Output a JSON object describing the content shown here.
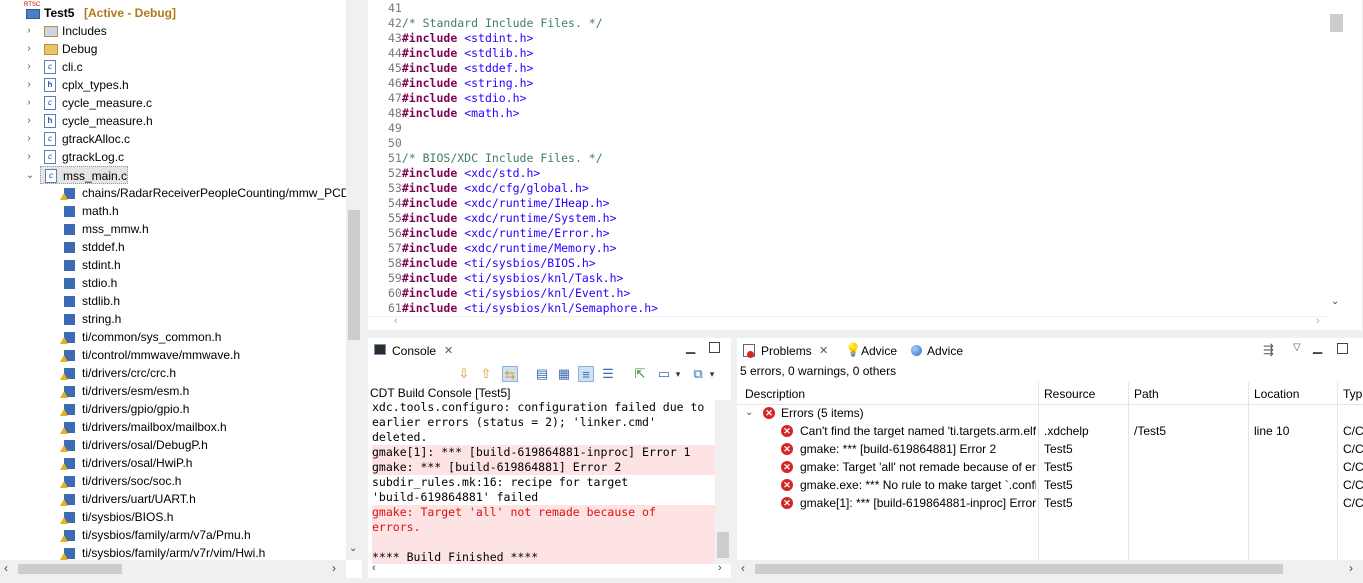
{
  "explorer": {
    "project": {
      "name": "Test5",
      "status": "[Active - Debug]",
      "badge": "RTSC"
    },
    "items": [
      {
        "label": "Includes",
        "icon": "includes-icon",
        "arrow": "›"
      },
      {
        "label": "Debug",
        "icon": "folder-icon",
        "arrow": "›"
      },
      {
        "label": "cli.c",
        "icon": "c-file-icon",
        "arrow": "›"
      },
      {
        "label": "cplx_types.h",
        "icon": "h-file-icon",
        "arrow": "›"
      },
      {
        "label": "cycle_measure.c",
        "icon": "c-file-icon",
        "arrow": "›"
      },
      {
        "label": "cycle_measure.h",
        "icon": "h-file-icon",
        "arrow": "›"
      },
      {
        "label": "gtrackAlloc.c",
        "icon": "c-file-icon",
        "arrow": "›"
      },
      {
        "label": "gtrackLog.c",
        "icon": "c-file-icon",
        "arrow": "›"
      },
      {
        "label": "mss_main.c",
        "icon": "c-file-icon",
        "arrow": "⌄"
      }
    ],
    "includes": [
      {
        "label": "chains/RadarReceiverPeopleCounting/mmw_PCD",
        "warn": true
      },
      {
        "label": "math.h",
        "warn": false
      },
      {
        "label": "mss_mmw.h",
        "warn": false
      },
      {
        "label": "stddef.h",
        "warn": false
      },
      {
        "label": "stdint.h",
        "warn": false
      },
      {
        "label": "stdio.h",
        "warn": false
      },
      {
        "label": "stdlib.h",
        "warn": false
      },
      {
        "label": "string.h",
        "warn": false
      },
      {
        "label": "ti/common/sys_common.h",
        "warn": true
      },
      {
        "label": "ti/control/mmwave/mmwave.h",
        "warn": true
      },
      {
        "label": "ti/drivers/crc/crc.h",
        "warn": true
      },
      {
        "label": "ti/drivers/esm/esm.h",
        "warn": true
      },
      {
        "label": "ti/drivers/gpio/gpio.h",
        "warn": true
      },
      {
        "label": "ti/drivers/mailbox/mailbox.h",
        "warn": true
      },
      {
        "label": "ti/drivers/osal/DebugP.h",
        "warn": true
      },
      {
        "label": "ti/drivers/osal/HwiP.h",
        "warn": true
      },
      {
        "label": "ti/drivers/soc/soc.h",
        "warn": true
      },
      {
        "label": "ti/drivers/uart/UART.h",
        "warn": true
      },
      {
        "label": "ti/sysbios/BIOS.h",
        "warn": true
      },
      {
        "label": "ti/sysbios/family/arm/v7a/Pmu.h",
        "warn": true
      },
      {
        "label": "ti/sysbios/family/arm/v7r/vim/Hwi.h",
        "warn": true
      }
    ]
  },
  "editor": {
    "lines": [
      {
        "n": "41",
        "kind": "blank",
        "text": ""
      },
      {
        "n": "42",
        "kind": "comment",
        "text": "/* Standard Include Files. */"
      },
      {
        "n": "43",
        "kind": "include",
        "text": "<stdint.h>"
      },
      {
        "n": "44",
        "kind": "include",
        "text": "<stdlib.h>"
      },
      {
        "n": "45",
        "kind": "include",
        "text": "<stddef.h>"
      },
      {
        "n": "46",
        "kind": "include",
        "text": "<string.h>"
      },
      {
        "n": "47",
        "kind": "include",
        "text": "<stdio.h>"
      },
      {
        "n": "48",
        "kind": "include",
        "text": "<math.h>"
      },
      {
        "n": "49",
        "kind": "blank",
        "text": ""
      },
      {
        "n": "50",
        "kind": "blank",
        "text": ""
      },
      {
        "n": "51",
        "kind": "comment",
        "text": "/* BIOS/XDC Include Files. */"
      },
      {
        "n": "52",
        "kind": "include",
        "text": "<xdc/std.h>"
      },
      {
        "n": "53",
        "kind": "include",
        "text": "<xdc/cfg/global.h>"
      },
      {
        "n": "54",
        "kind": "include",
        "text": "<xdc/runtime/IHeap.h>"
      },
      {
        "n": "55",
        "kind": "include",
        "text": "<xdc/runtime/System.h>"
      },
      {
        "n": "56",
        "kind": "include",
        "text": "<xdc/runtime/Error.h>"
      },
      {
        "n": "57",
        "kind": "include",
        "text": "<xdc/runtime/Memory.h>"
      },
      {
        "n": "58",
        "kind": "include",
        "text": "<ti/sysbios/BIOS.h>"
      },
      {
        "n": "59",
        "kind": "include",
        "text": "<ti/sysbios/knl/Task.h>"
      },
      {
        "n": "60",
        "kind": "include",
        "text": "<ti/sysbios/knl/Event.h>"
      },
      {
        "n": "61",
        "kind": "include",
        "text": "<ti/sysbios/knl/Semaphore.h>"
      }
    ],
    "include_keyword": "#include"
  },
  "console": {
    "tab_label": "Console",
    "title": "CDT Build Console [Test5]",
    "lines": [
      {
        "text": "xdc.tools.configuro: configuration failed due to",
        "kind": "plain"
      },
      {
        "text": "earlier errors (status = 2); 'linker.cmd'",
        "kind": "plain"
      },
      {
        "text": "deleted.",
        "kind": "plain"
      },
      {
        "text": "gmake[1]: *** [build-619864881-inproc] Error 1",
        "kind": "norm"
      },
      {
        "text": "gmake: *** [build-619864881] Error 2",
        "kind": "norm"
      },
      {
        "text": "subdir_rules.mk:16: recipe for target",
        "kind": "plain"
      },
      {
        "text": "'build-619864881' failed",
        "kind": "plain"
      },
      {
        "text": "gmake: Target 'all' not remade because of",
        "kind": "err"
      },
      {
        "text": "errors.",
        "kind": "err"
      },
      {
        "text": "",
        "kind": "plain"
      },
      {
        "text": "**** Build Finished ****",
        "kind": "norm"
      }
    ]
  },
  "problems": {
    "tabs": [
      {
        "label": "Problems",
        "icon": "problems-icon"
      },
      {
        "label": "Advice",
        "icon": "lightbulb-icon"
      },
      {
        "label": "Advice",
        "icon": "globe-icon"
      }
    ],
    "summary": "5 errors, 0 warnings, 0 others",
    "columns": [
      "Description",
      "Resource",
      "Path",
      "Location",
      "Typ"
    ],
    "group": "Errors (5 items)",
    "rows": [
      {
        "description": "Can't find the target named 'ti.targets.arm.elf",
        "resource": ".xdchelp",
        "path": "/Test5",
        "location": "line 10",
        "type": "C/C"
      },
      {
        "description": "gmake: *** [build-619864881] Error 2",
        "resource": "Test5",
        "path": "",
        "location": "",
        "type": "C/C"
      },
      {
        "description": "gmake: Target 'all' not remade because of err",
        "resource": "Test5",
        "path": "",
        "location": "",
        "type": "C/C"
      },
      {
        "description": "gmake.exe: *** No rule to make target `.confi",
        "resource": "Test5",
        "path": "",
        "location": "",
        "type": "C/C"
      },
      {
        "description": "gmake[1]: *** [build-619864881-inproc] Error",
        "resource": "Test5",
        "path": "",
        "location": "",
        "type": "C/C"
      }
    ]
  }
}
